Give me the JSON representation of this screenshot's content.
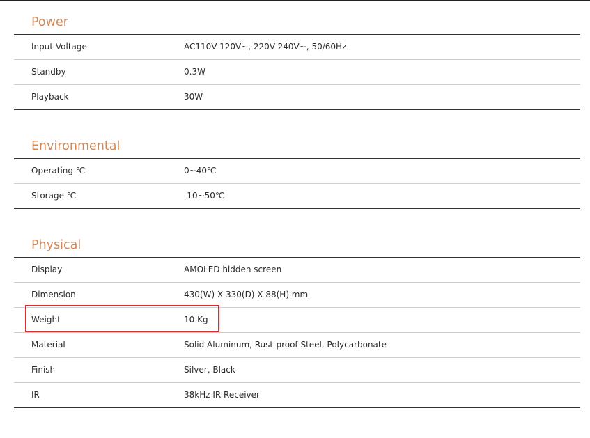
{
  "sections": [
    {
      "title": "Power",
      "rows": [
        {
          "label": "Input Voltage",
          "value": "AC110V-120V~, 220V-240V~, 50/60Hz"
        },
        {
          "label": "Standby",
          "value": "0.3W"
        },
        {
          "label": "Playback",
          "value": "30W"
        }
      ]
    },
    {
      "title": "Environmental",
      "rows": [
        {
          "label": "Operating ℃",
          "value": "0~40℃"
        },
        {
          "label": "Storage ℃",
          "value": "-10~50℃"
        }
      ]
    },
    {
      "title": "Physical",
      "rows": [
        {
          "label": "Display",
          "value": "AMOLED hidden screen"
        },
        {
          "label": "Dimension",
          "value": "430(W) X 330(D) X 88(H) mm"
        },
        {
          "label": "Weight",
          "value": "10 Kg"
        },
        {
          "label": "Material",
          "value": "Solid Aluminum, Rust-proof Steel, Polycarbonate"
        },
        {
          "label": "Finish",
          "value": "Silver, Black"
        },
        {
          "label": "IR",
          "value": "38kHz IR Receiver"
        }
      ]
    }
  ],
  "highlight_color": "#d32f2f",
  "title_color": "#d0895a"
}
